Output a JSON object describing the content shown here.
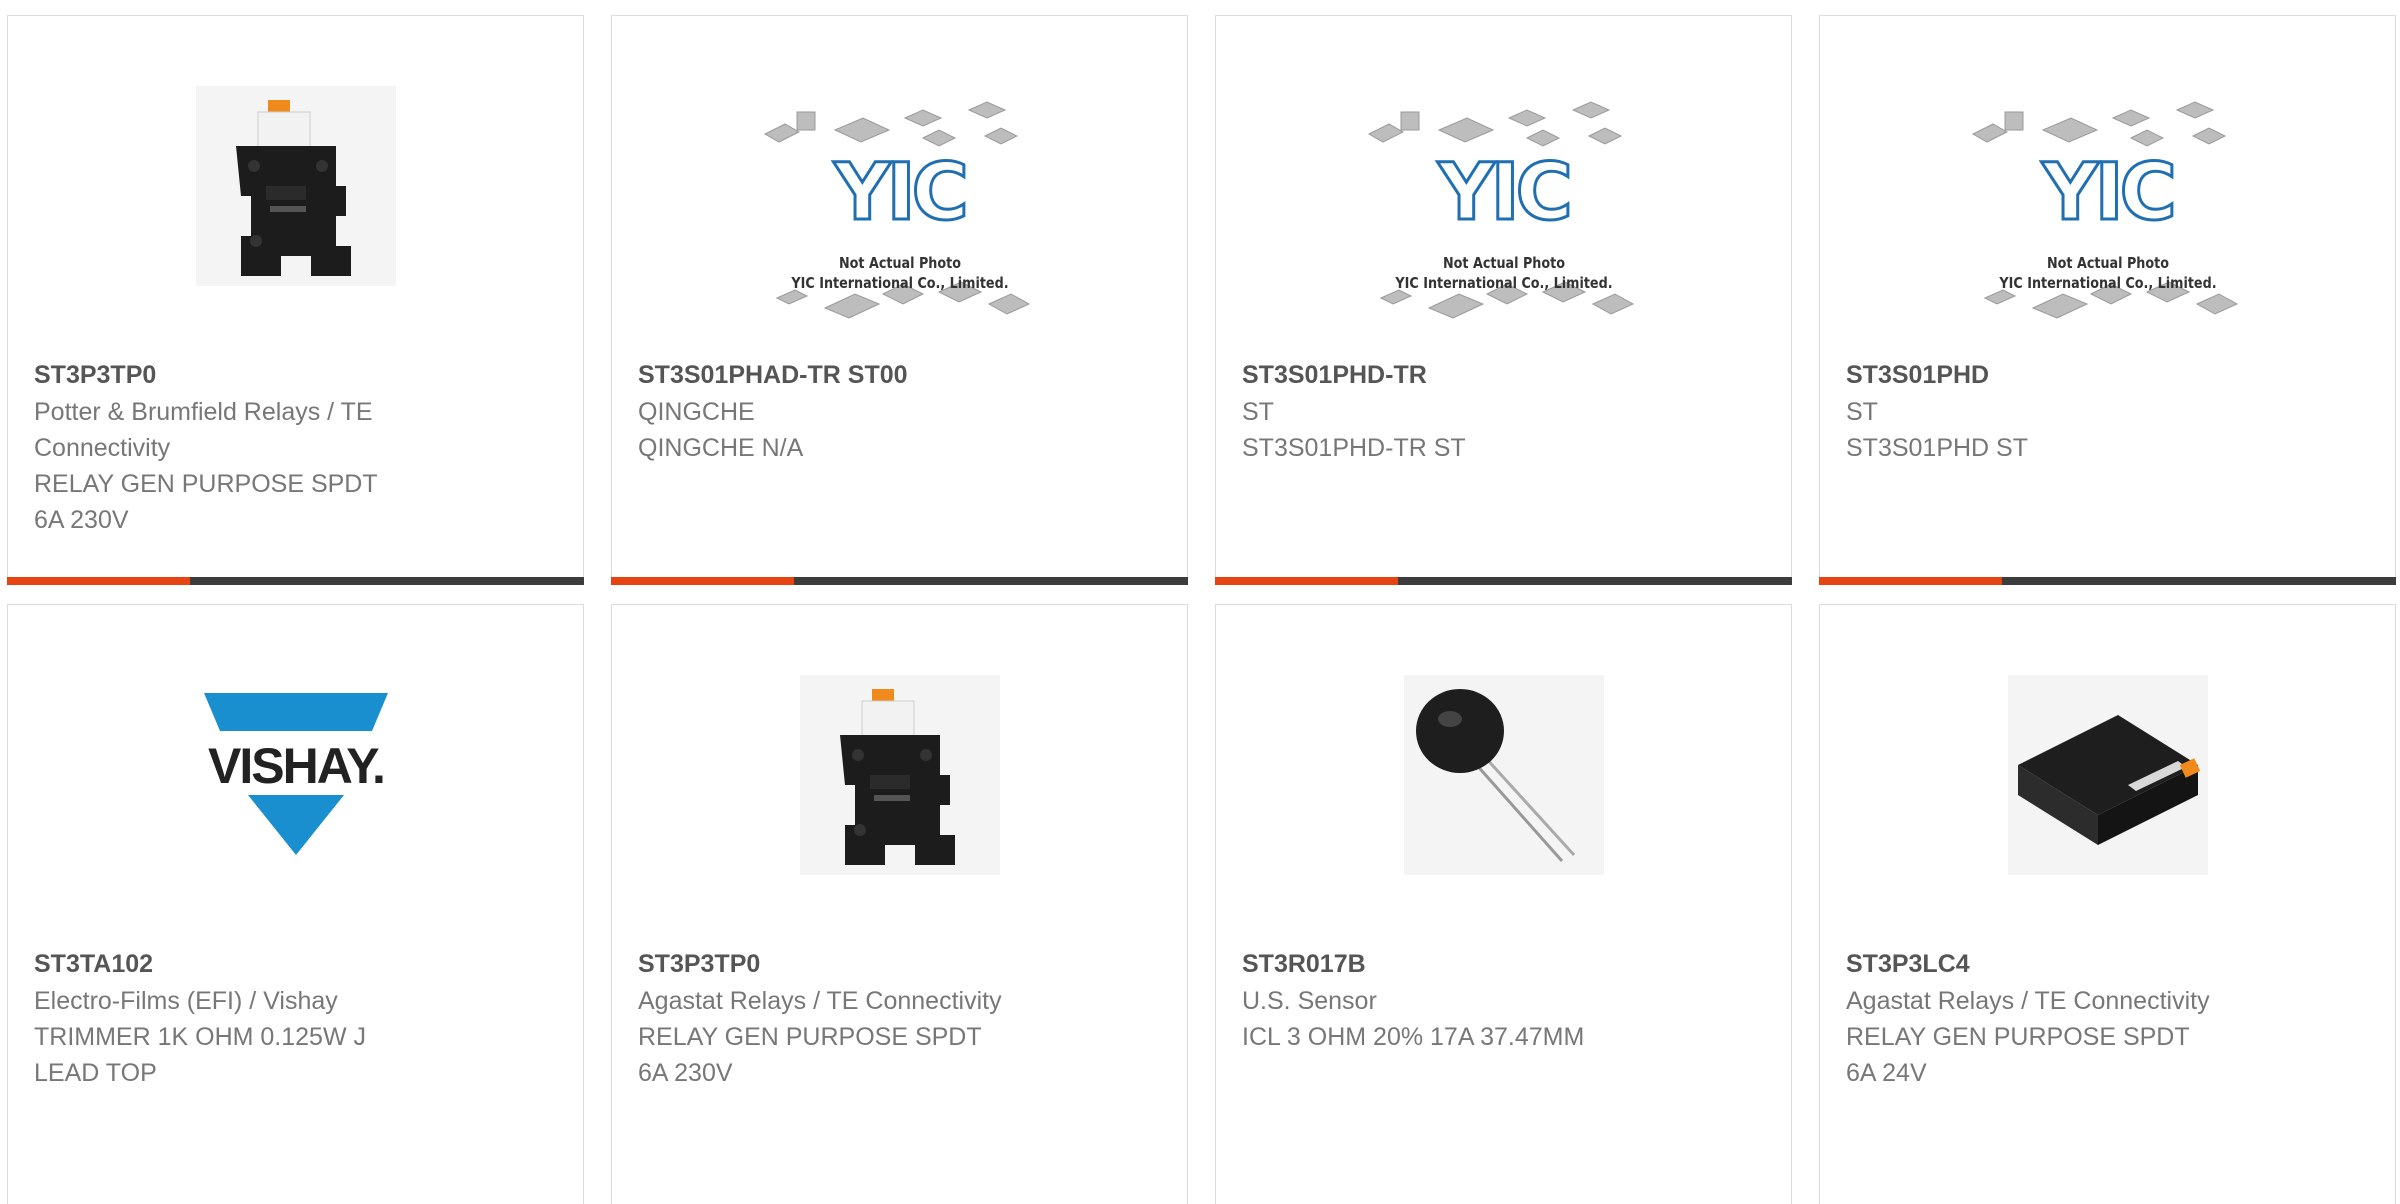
{
  "products": [
    {
      "part": "ST3P3TP0",
      "lines": [
        "Potter & Brumfield Relays / TE",
        "Connectivity",
        "RELAY GEN PURPOSE SPDT",
        "6A 230V"
      ],
      "image": "relay-socket-photo"
    },
    {
      "part": "ST3S01PHAD-TR ST00",
      "lines": [
        "QINGCHE",
        "QINGCHE N/A"
      ],
      "image": "yic-placeholder",
      "placeholder": {
        "logo": "YIC",
        "caption1": "Not Actual Photo",
        "caption2": "YIC International Co., Limited."
      }
    },
    {
      "part": "ST3S01PHD-TR",
      "lines": [
        "ST",
        "ST3S01PHD-TR ST"
      ],
      "image": "yic-placeholder",
      "placeholder": {
        "logo": "YIC",
        "caption1": "Not Actual Photo",
        "caption2": "YIC International Co., Limited."
      }
    },
    {
      "part": "ST3S01PHD",
      "lines": [
        "ST",
        "ST3S01PHD ST"
      ],
      "image": "yic-placeholder",
      "placeholder": {
        "logo": "YIC",
        "caption1": "Not Actual Photo",
        "caption2": "YIC International Co., Limited."
      }
    },
    {
      "part": "ST3TA102",
      "lines": [
        "Electro-Films (EFI) / Vishay",
        "TRIMMER 1K OHM 0.125W J",
        "LEAD TOP"
      ],
      "image": "vishay-logo",
      "logo_text": "VISHAY."
    },
    {
      "part": "ST3P3TP0",
      "lines": [
        "Agastat Relays / TE Connectivity",
        "RELAY GEN PURPOSE SPDT",
        "6A 230V"
      ],
      "image": "relay-socket-photo"
    },
    {
      "part": "ST3R017B",
      "lines": [
        "U.S. Sensor",
        "ICL 3 OHM 20% 17A 37.47MM"
      ],
      "image": "thermistor-photo"
    },
    {
      "part": "ST3P3LC4",
      "lines": [
        "Agastat Relays / TE Connectivity",
        "RELAY GEN PURPOSE SPDT",
        "6A 24V"
      ],
      "image": "relay-module-photo"
    }
  ],
  "colors": {
    "accent": "#e64411",
    "bar": "#3c3c3c",
    "vishay_blue": "#1a8fd0",
    "border": "#dcdcdc"
  }
}
